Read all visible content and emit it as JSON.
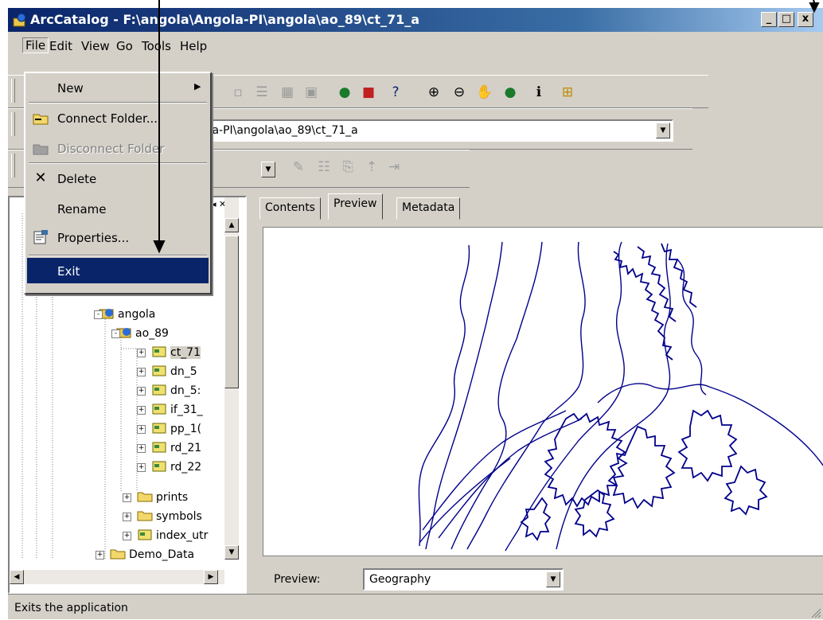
{
  "window": {
    "title": "ArcCatalog - F:\\angola\\Angola-PI\\angola\\ao_89\\ct_71_a",
    "controls": [
      "_",
      "□",
      "x"
    ]
  },
  "menubar": {
    "items": [
      "File",
      "Edit",
      "View",
      "Go",
      "Tools",
      "Help"
    ]
  },
  "address": {
    "value": "ola-PI\\angola\\ao_89\\ct_71_a"
  },
  "file_menu": {
    "items": [
      {
        "label": "New",
        "icon": "none",
        "has_submenu": true,
        "enabled": true
      },
      {
        "label": "Connect Folder...",
        "icon": "connect-folder-icon",
        "enabled": true
      },
      {
        "label": "Disconnect Folder",
        "icon": "disconnect-folder-icon",
        "enabled": false
      },
      {
        "label": "Delete",
        "icon": "delete-x-icon",
        "enabled": true
      },
      {
        "label": "Rename",
        "icon": "none",
        "enabled": true
      },
      {
        "label": "Properties...",
        "icon": "properties-icon",
        "enabled": true
      },
      {
        "label": "Exit",
        "icon": "none",
        "enabled": true,
        "highlighted": true
      }
    ]
  },
  "tree": {
    "items": [
      {
        "label": "angola",
        "kind": "globe-folder"
      },
      {
        "label": "ao_89",
        "kind": "globe-folder"
      },
      {
        "label": "ct_71",
        "kind": "coverage",
        "selected": true
      },
      {
        "label": "dn_5",
        "kind": "coverage"
      },
      {
        "label": "dn_5:",
        "kind": "coverage"
      },
      {
        "label": "if_31_",
        "kind": "coverage"
      },
      {
        "label": "pp_1(",
        "kind": "coverage"
      },
      {
        "label": "rd_21",
        "kind": "coverage"
      },
      {
        "label": "rd_22",
        "kind": "coverage"
      },
      {
        "label": "prints",
        "kind": "folder"
      },
      {
        "label": "symbols",
        "kind": "folder"
      },
      {
        "label": "index_utr",
        "kind": "coverage"
      },
      {
        "label": "Demo_Data",
        "kind": "folder"
      }
    ]
  },
  "tabs": [
    "Contents",
    "Preview",
    "Metadata"
  ],
  "active_tab": "Preview",
  "preview": {
    "label": "Preview:",
    "value": "Geography",
    "line_color": "#00008b"
  },
  "status": {
    "text": "Exits the application"
  },
  "colors": {
    "title_start": "#0a246a",
    "highlight": "#0a246a",
    "face": "#d4d0c8"
  }
}
